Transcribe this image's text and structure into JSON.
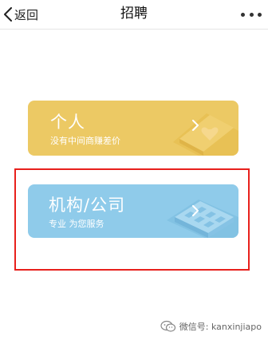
{
  "nav": {
    "back_label": "返回",
    "title": "招聘",
    "more_icon": "more-dots-icon"
  },
  "cards": [
    {
      "title": "个人",
      "subtitle": "没有中间商赚差价",
      "color": "#ecc964",
      "icon": "heart-card-icon"
    },
    {
      "title": "机构/公司",
      "subtitle": "专业 为您服务",
      "color": "#8fcbea",
      "icon": "building-icon"
    }
  ],
  "highlight": {
    "color": "#e8201c"
  },
  "watermark": {
    "text": "微信号: kanxinjiapo",
    "icon": "wechat-icon"
  }
}
